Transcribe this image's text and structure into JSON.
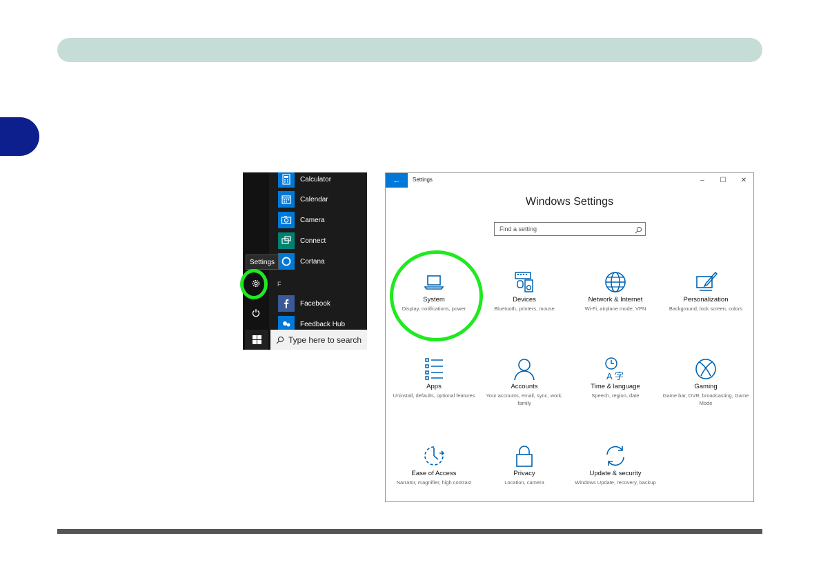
{
  "start_menu": {
    "apps": [
      {
        "label": "Calculator",
        "icon": "calculator-icon"
      },
      {
        "label": "Calendar",
        "icon": "calendar-icon"
      },
      {
        "label": "Camera",
        "icon": "camera-icon"
      },
      {
        "label": "Connect",
        "icon": "connect-icon"
      },
      {
        "label": "Cortana",
        "icon": "cortana-icon"
      },
      {
        "label": "Facebook",
        "icon": "facebook-icon"
      },
      {
        "label": "Feedback Hub",
        "icon": "feedback-hub-icon"
      }
    ],
    "section_letter": "F",
    "tooltip": "Settings",
    "search_placeholder": "Type here to search"
  },
  "settings_window": {
    "title": "Settings",
    "heading": "Windows Settings",
    "search_placeholder": "Find a setting",
    "controls": {
      "minimize": "–",
      "maximize": "☐",
      "close": "✕"
    },
    "categories": [
      {
        "name": "System",
        "desc": "Display, notifications, power",
        "icon": "laptop-icon"
      },
      {
        "name": "Devices",
        "desc": "Bluetooth, printers, mouse",
        "icon": "devices-icon"
      },
      {
        "name": "Network & Internet",
        "desc": "Wi-Fi, airplane mode, VPN",
        "icon": "globe-icon"
      },
      {
        "name": "Personalization",
        "desc": "Background, lock screen, colors",
        "icon": "paintbrush-icon"
      },
      {
        "name": "Apps",
        "desc": "Uninstall, defaults, optional features",
        "icon": "apps-list-icon"
      },
      {
        "name": "Accounts",
        "desc": "Your accounts, email, sync, work, family",
        "icon": "person-icon"
      },
      {
        "name": "Time & language",
        "desc": "Speech, region, date",
        "icon": "time-language-icon"
      },
      {
        "name": "Gaming",
        "desc": "Game bar, DVR, broadcasting, Game Mode",
        "icon": "xbox-icon"
      },
      {
        "name": "Ease of Access",
        "desc": "Narrator, magnifier, high contrast",
        "icon": "ease-of-access-icon"
      },
      {
        "name": "Privacy",
        "desc": "Location, camera",
        "icon": "lock-icon"
      },
      {
        "name": "Update & security",
        "desc": "Windows Update, recovery, backup",
        "icon": "sync-icon"
      }
    ]
  },
  "colors": {
    "accent": "#0078d7",
    "highlight": "#1fe91f",
    "chapter_tab": "#0d1f8c",
    "header_bar": "#c6dcd6"
  }
}
